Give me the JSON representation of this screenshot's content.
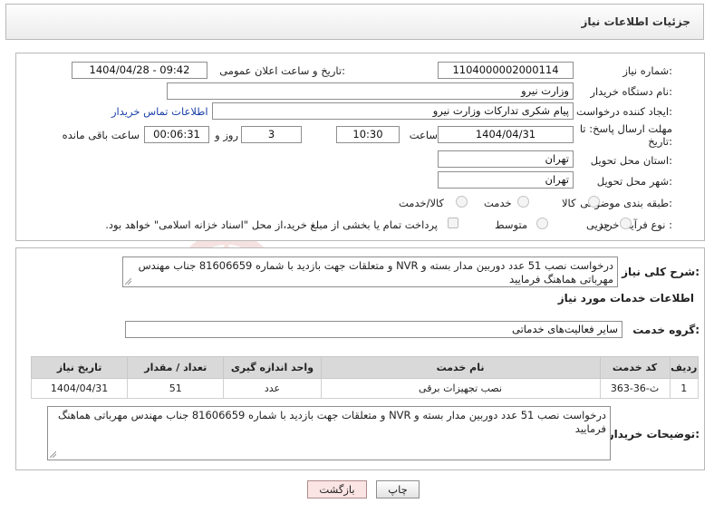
{
  "header": {
    "title": "جزئیات اطلاعات نیاز"
  },
  "form": {
    "need_number": {
      "label": "شماره نیاز:",
      "value": "1104000002000114"
    },
    "announce_datetime": {
      "label": "تاریخ و ساعت اعلان عمومی:",
      "value": "1404/04/28 - 09:42"
    },
    "buyer_org": {
      "label": "نام دستگاه خریدار:",
      "value": "وزارت نیرو"
    },
    "requester": {
      "label": "ایجاد کننده درخواست:",
      "value": "پیام شکری تدارکات وزارت نیرو",
      "contact_link": "اطلاعات تماس خریدار"
    },
    "deadline": {
      "label": "مهلت ارسال پاسخ: تا تاریخ:",
      "date": "1404/04/31",
      "time_label": "ساعت",
      "time": "10:30",
      "days": "3",
      "days_label": "روز و",
      "remaining": "00:06:31",
      "remaining_label": "ساعت باقی مانده"
    },
    "province": {
      "label": "استان محل تحویل:",
      "value": "تهران"
    },
    "city": {
      "label": "شهر محل تحویل:",
      "value": "تهران"
    },
    "category": {
      "label": "طبقه بندی موضوعی:",
      "options": [
        "کالا",
        "خدمت",
        "کالا/خدمت"
      ]
    },
    "process_type": {
      "label": "نوع فرآیند خرید :",
      "options": [
        "جزیی",
        "متوسط"
      ],
      "payment_note": "پرداخت تمام یا بخشی از مبلغ خرید،از محل \"اسناد خزانه اسلامی\" خواهد بود."
    }
  },
  "general_desc": {
    "label": "شرح کلی نیاز:",
    "text": "درخواست نصب 51 عدد دوربین مدار بسته و NVR و متعلقات جهت بازدید با شماره 81606659 جناب مهندس مهرباتی هماهنگ فرمایید"
  },
  "services": {
    "title": "اطلاعات خدمات مورد نیاز",
    "group_label": "گروه خدمت:",
    "group_value": "سایر فعالیت‌های خدماتی",
    "columns": [
      "ردیف",
      "کد خدمت",
      "نام خدمت",
      "واحد اندازه گیری",
      "تعداد / مقدار",
      "تاریخ نیاز"
    ],
    "rows": [
      [
        "1",
        "ث-36-363",
        "نصب تجهیزات برقی",
        "عدد",
        "51",
        "1404/04/31"
      ]
    ]
  },
  "buyer_notes": {
    "label": "توضیحات خریدار:",
    "text": "درخواست نصب 51 عدد دوربین مدار بسته و NVR و متعلقات جهت بازدید با شماره 81606659 جناب مهندس مهرباتی هماهنگ فرمایید"
  },
  "buttons": {
    "print": "چاپ",
    "back": "بازگشت"
  },
  "watermark_text": "AriaTender.net"
}
